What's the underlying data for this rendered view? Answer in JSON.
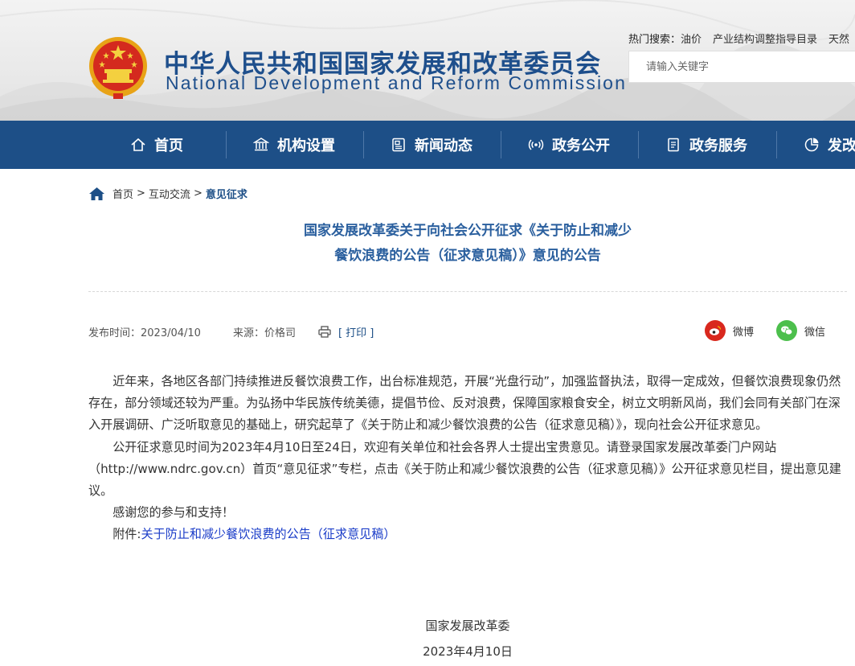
{
  "header": {
    "title_cn": "中华人民共和国国家发展和改革委员会",
    "title_en": "National Development and Reform Commission",
    "hot_search_label": "热门搜索：",
    "hot_search_items": [
      "油价",
      "产业结构调整指导目录",
      "天然"
    ],
    "search_placeholder": "请输入关键字"
  },
  "nav": {
    "items": [
      {
        "label": "首页",
        "icon": "home-icon"
      },
      {
        "label": "机构设置",
        "icon": "institution-icon"
      },
      {
        "label": "新闻动态",
        "icon": "news-icon"
      },
      {
        "label": "政务公开",
        "icon": "broadcast-icon"
      },
      {
        "label": "政务服务",
        "icon": "document-icon"
      },
      {
        "label": "发改",
        "icon": "pie-chart-icon"
      }
    ]
  },
  "breadcrumb": {
    "home": "首页",
    "sep": ">",
    "level1": "互动交流",
    "current": "意见征求"
  },
  "article": {
    "title_line1": "国家发展改革委关于向社会公开征求《关于防止和减少",
    "title_line2": "餐饮浪费的公告（征求意见稿）》意见的公告",
    "publish_time": "发布时间：2023/04/10",
    "source": "来源：价格司",
    "print_label": "[ 打印 ]",
    "share_weibo": "微博",
    "share_wechat": "微信",
    "para1": "近年来，各地区各部门持续推进反餐饮浪费工作，出台标准规范，开展“光盘行动”，加强监督执法，取得一定成效，但餐饮浪费现象仍然存在，部分领域还较为严重。为弘扬中华民族传统美德，提倡节俭、反对浪费，保障国家粮食安全，树立文明新风尚，我们会同有关部门在深入开展调研、广泛听取意见的基础上，研究起草了《关于防止和减少餐饮浪费的公告（征求意见稿）》，现向社会公开征求意见。",
    "para2_a": "公开征求意见时间为2023年4月10日至24日，欢迎有关单位和社会各界人士提出宝贵意见。请登录国家发展改革委门户网站（",
    "para2_url": "http://www.ndrc.gov.cn",
    "para2_b": "）首页“意见征求”专栏，点击《关于防止和减少餐饮浪费的公告（征求意见稿）》公开征求意见栏目，提出意见建议。",
    "para3": "感谢您的参与和支持！",
    "attachment_label": "附件:",
    "attachment_link": "关于防止和减少餐饮浪费的公告（征求意见稿）",
    "signature_org": "国家发展改革委",
    "signature_date": "2023年4月10日"
  },
  "colors": {
    "nav_bg": "#1d4f87",
    "title_blue": "#1e4f8c",
    "article_title": "#2a5f9e",
    "link_blue": "#1a3cc8",
    "weibo_red": "#d9281e",
    "wechat_green": "#4cbf4c"
  }
}
